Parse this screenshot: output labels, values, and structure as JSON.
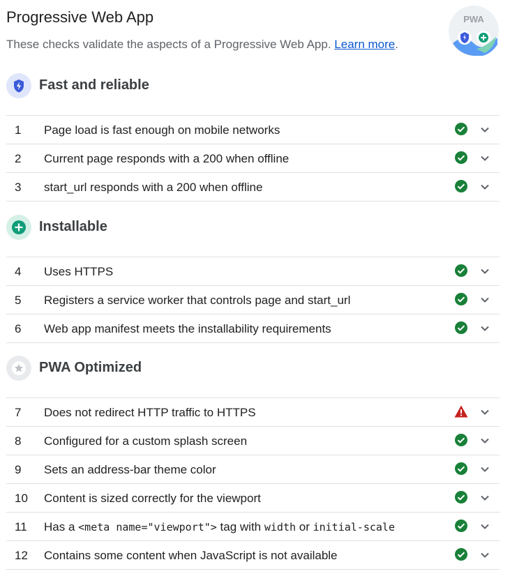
{
  "header": {
    "title": "Progressive Web App",
    "description": "These checks validate the aspects of a Progressive Web App.",
    "learn_more": "Learn more",
    "period": ".",
    "badge_text": "PWA"
  },
  "colors": {
    "pass": "#188038",
    "warn": "#c5221f",
    "link": "#0b57d0"
  },
  "groups": [
    {
      "title": "Fast and reliable",
      "icon": "lightning-shield-icon",
      "audits": [
        {
          "num": "1",
          "label": "Page load is fast enough on mobile networks",
          "status": "pass"
        },
        {
          "num": "2",
          "label": "Current page responds with a 200 when offline",
          "status": "pass"
        },
        {
          "num": "3",
          "label": "start_url responds with a 200 when offline",
          "status": "pass"
        }
      ]
    },
    {
      "title": "Installable",
      "icon": "plus-circle-icon",
      "audits": [
        {
          "num": "4",
          "label": "Uses HTTPS",
          "status": "pass"
        },
        {
          "num": "5",
          "label": "Registers a service worker that controls page and start_url",
          "status": "pass"
        },
        {
          "num": "6",
          "label": "Web app manifest meets the installability requirements",
          "status": "pass"
        }
      ]
    },
    {
      "title": "PWA Optimized",
      "icon": "star-icon",
      "audits": [
        {
          "num": "7",
          "label": "Does not redirect HTTP traffic to HTTPS",
          "status": "warn"
        },
        {
          "num": "8",
          "label": "Configured for a custom splash screen",
          "status": "pass"
        },
        {
          "num": "9",
          "label": "Sets an address-bar theme color",
          "status": "pass"
        },
        {
          "num": "10",
          "label": "Content is sized correctly for the viewport",
          "status": "pass"
        },
        {
          "num": "11",
          "label_parts": {
            "a": "Has a ",
            "b": "<meta name=\"viewport\">",
            "c": " tag with ",
            "d": "width",
            "e": " or ",
            "f": "initial-scale"
          },
          "status": "pass"
        },
        {
          "num": "12",
          "label": "Contains some content when JavaScript is not available",
          "status": "pass"
        }
      ]
    }
  ]
}
